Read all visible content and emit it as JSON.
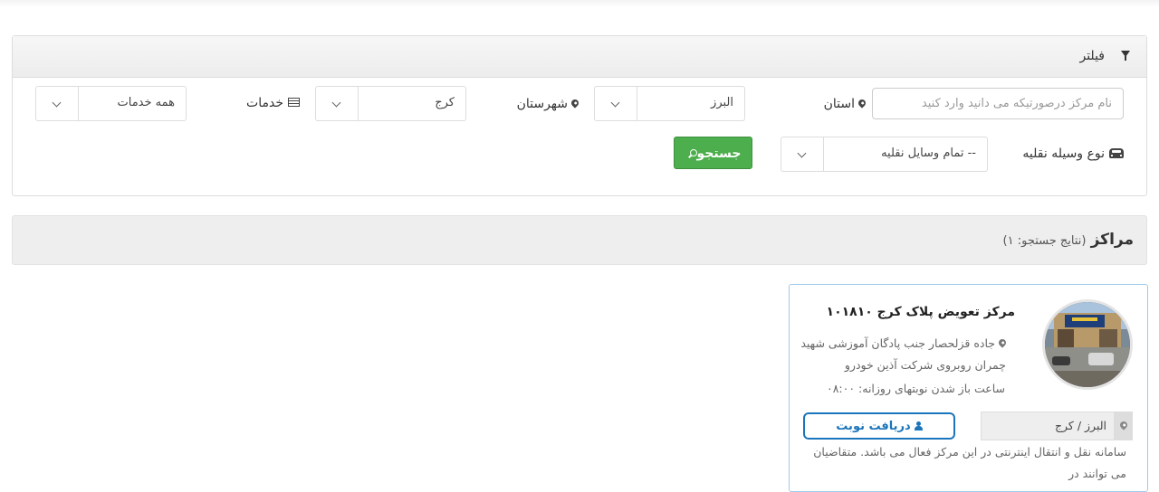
{
  "filter": {
    "title": "فیلتر",
    "name_placeholder": "نام مرکز درصورتیکه می دانید وارد کنید",
    "province_label": "استان",
    "province_value": "البرز",
    "city_label": "شهرستان",
    "city_value": "کرج",
    "services_label": "خدمات",
    "services_value": "همه خدمات",
    "vehicle_label": "نوع وسیله نقلیه",
    "vehicle_value": "-- تمام وسایل نقلیه",
    "search_label": "جستجو"
  },
  "results": {
    "title": "مراکز",
    "count_text": "(نتایج جستجو: ۱)"
  },
  "center": {
    "name": "مرکز تعویض پلاک کرج ۱۰۱۸۱۰",
    "address": "جاده قزلحصار جنب پادگان آموزشی شهید چمران روبروی شرکت آذین خودرو",
    "hours": "ساعت باز شدن نوبتهای روزانه: ۰۸:۰۰",
    "location": "البرز / کرج",
    "appointment_label": "دریافت نوبت",
    "description": "سامانه نقل و انتقال اینترنتی در این مرکز فعال می باشد. متقاضیان می توانند در"
  }
}
